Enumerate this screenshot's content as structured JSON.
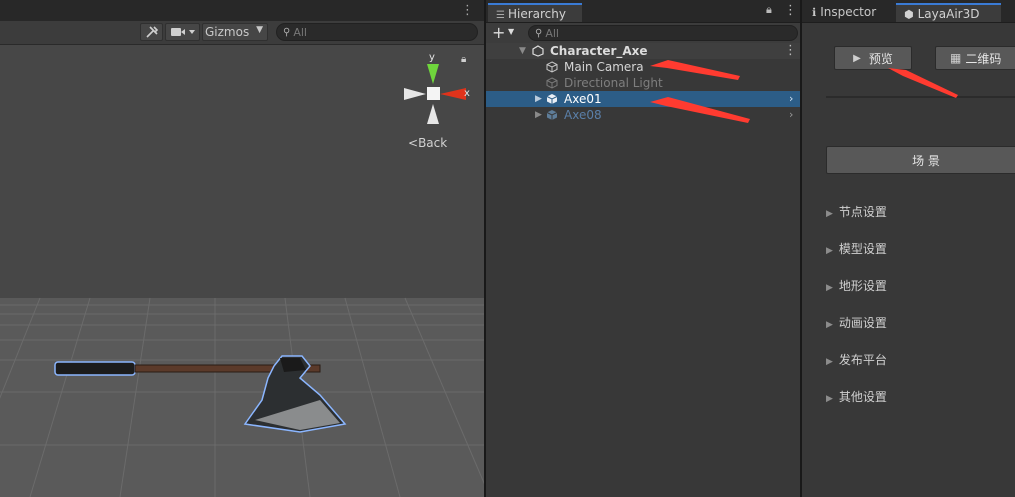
{
  "scene": {
    "tools_icon": "tools-icon",
    "camera_icon": "camera-icon",
    "gizmos_label": "Gizmos",
    "search_placeholder": "All",
    "gizmo_axis_y": "y",
    "gizmo_axis_x": "x",
    "gizmo_view_label": "Back"
  },
  "hierarchy": {
    "tab_label": "Hierarchy",
    "search_placeholder": "All",
    "add_label": "+",
    "root": "Character_Axe",
    "items": [
      {
        "label": "Main Camera",
        "state": "normal"
      },
      {
        "label": "Directional Light",
        "state": "disabled"
      },
      {
        "label": "Axe01",
        "state": "selected"
      },
      {
        "label": "Axe08",
        "state": "prefab-inactive"
      }
    ]
  },
  "inspector": {
    "tabs": [
      {
        "label": "Inspector",
        "icon": "info-icon"
      },
      {
        "label": "LayaAir3D",
        "icon": "unity-cube-icon"
      }
    ],
    "preview_label": "预览",
    "qrcode_label": "二维码",
    "scene_label": "场 景",
    "sections": [
      "节点设置",
      "模型设置",
      "地形设置",
      "动画设置",
      "发布平台",
      "其他设置"
    ]
  },
  "colors": {
    "selection": "#2c5d87",
    "annotation_arrow": "#ff3b30",
    "gizmo_y": "#6fd63c",
    "gizmo_x": "#e0331b"
  }
}
